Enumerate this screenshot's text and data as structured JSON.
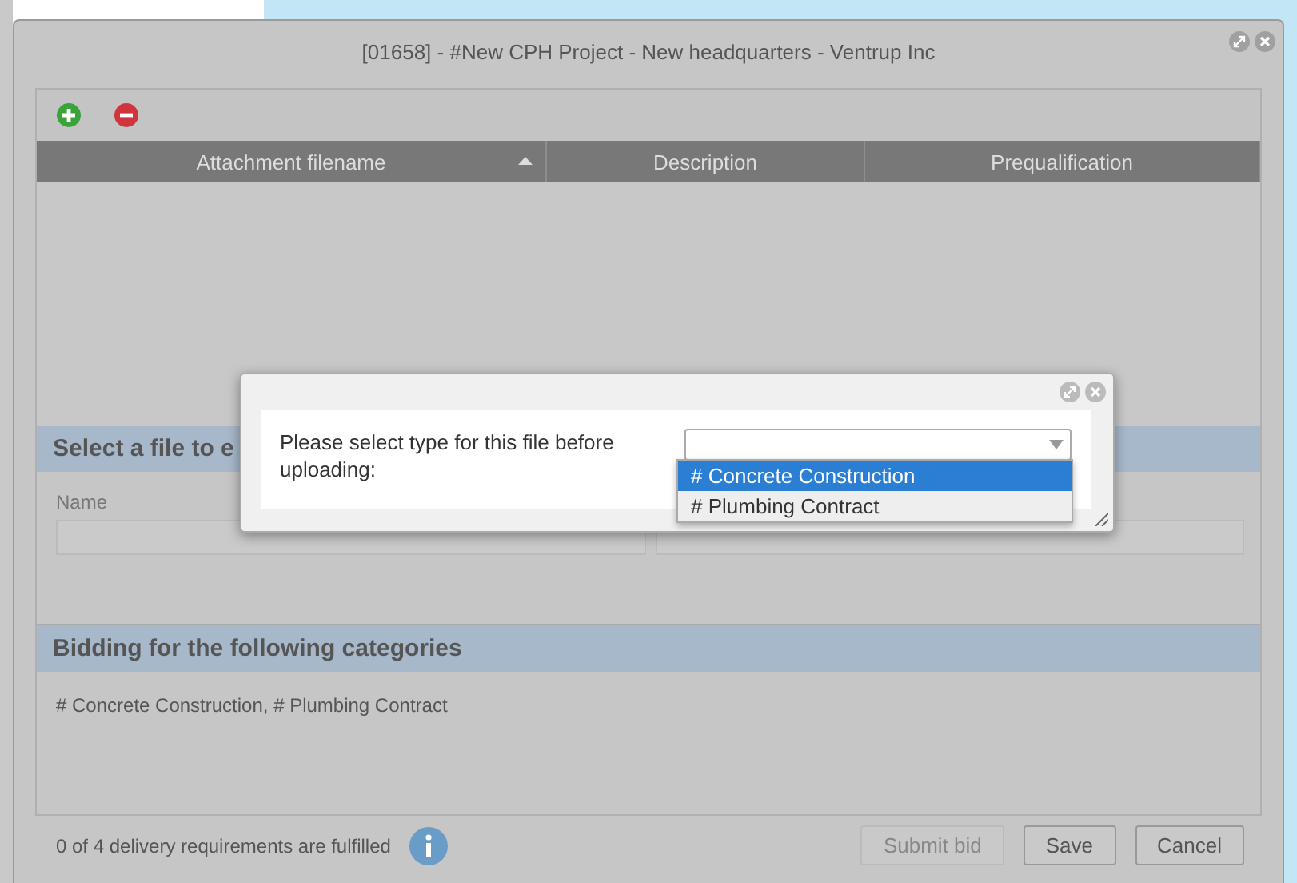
{
  "window": {
    "title": "[01658] - #New CPH Project - New headquarters - Ventrup Inc"
  },
  "toolbar": {
    "buttons": [
      {
        "kind": "add"
      },
      {
        "kind": "remove"
      }
    ]
  },
  "table": {
    "columns": [
      {
        "label": "Attachment filename",
        "sorted": true
      },
      {
        "label": "Description",
        "sorted": false
      },
      {
        "label": "Prequalification",
        "sorted": false
      }
    ]
  },
  "edit_section": {
    "heading": "Select a file to e",
    "name_field": {
      "label": "Name"
    }
  },
  "bidding": {
    "heading": "Bidding for the following categories",
    "text": "# Concrete Construction, # Plumbing Contract"
  },
  "status": {
    "text": "0 of 4 delivery requirements are fulfilled"
  },
  "buttons": [
    {
      "label": "Submit bid",
      "disabled": true
    },
    {
      "label": "Save",
      "disabled": false
    },
    {
      "label": "Cancel",
      "disabled": false
    }
  ],
  "dialog": {
    "prompt": "Please select type for this file before uploading:",
    "options": [
      {
        "label": "# Concrete Construction",
        "selected": true
      },
      {
        "label": "# Plumbing Contract",
        "selected": false
      }
    ]
  }
}
